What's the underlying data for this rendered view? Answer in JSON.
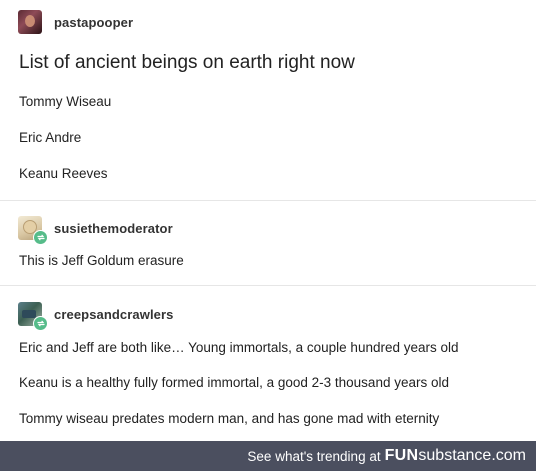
{
  "posts": [
    {
      "username": "pastapooper",
      "avatar_icon": "user-avatar-icon",
      "title": "List of ancient beings on earth right now",
      "lines": [
        "Tommy Wiseau",
        "Eric Andre",
        "Keanu Reeves"
      ]
    },
    {
      "username": "susiethemoderator",
      "avatar_icon": "user-avatar-icon",
      "badge_icon": "reblog-icon",
      "lines": [
        "This is Jeff Goldum erasure"
      ]
    },
    {
      "username": "creepsandcrawlers",
      "avatar_icon": "user-avatar-icon",
      "badge_icon": "reblog-icon",
      "lines": [
        "Eric and Jeff are both like… Young immortals, a couple hundred years old",
        "Keanu is a healthy fully formed immortal, a good 2-3 thousand years old",
        "Tommy wiseau predates modern man, and has gone mad with eternity"
      ]
    }
  ],
  "footer": {
    "trending_text": "See what's trending at",
    "brand_bold": "FUN",
    "brand_light": "substance.com"
  },
  "colors": {
    "footer_bg": "#4b4f5f",
    "reblog_badge": "#56bc8a",
    "text": "#222222"
  }
}
